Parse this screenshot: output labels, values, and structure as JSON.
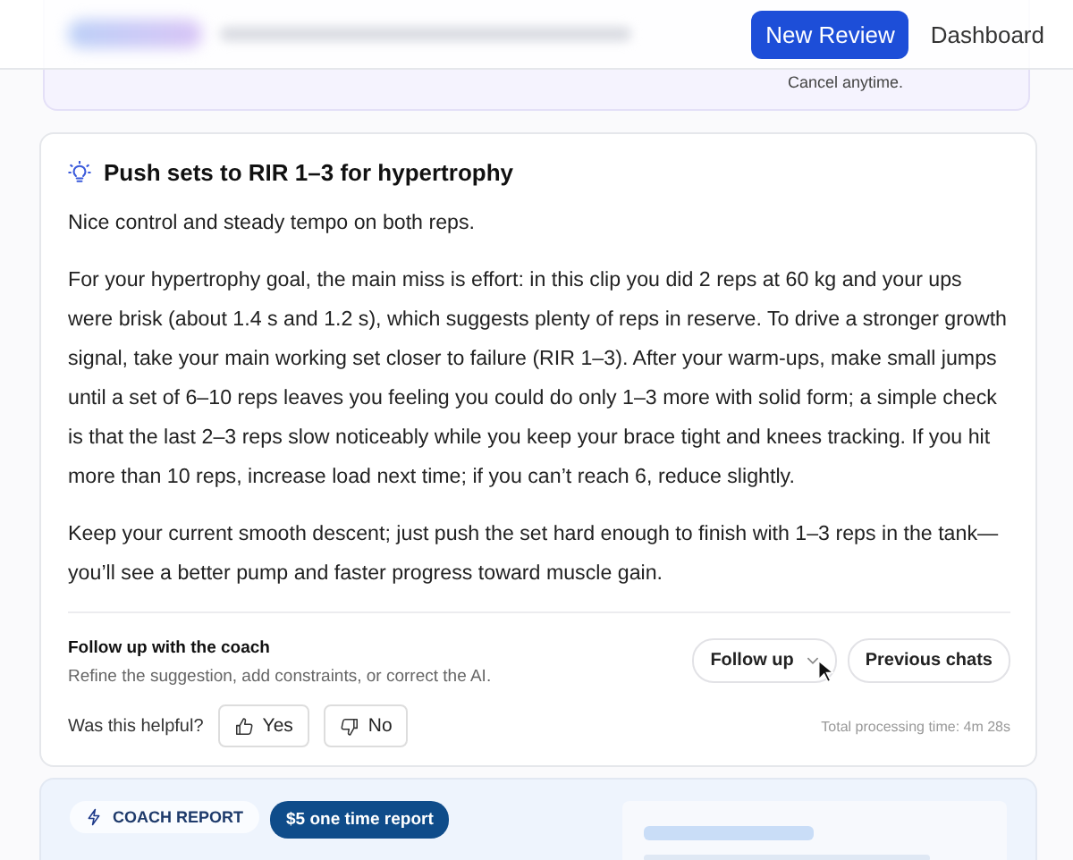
{
  "header": {
    "buttons": [
      {
        "label": "New Review",
        "selected": true
      },
      {
        "label": "Dashboard",
        "selected": false
      }
    ]
  },
  "banner": {
    "note": "Cancel anytime."
  },
  "suggestion": {
    "title": "Push sets to RIR 1–3 for hypertrophy",
    "paragraphs": [
      "Nice control and steady tempo on both reps.",
      "For your hypertrophy goal, the main miss is effort: in this clip you did 2 reps at 60 kg and your ups were brisk (about 1.4 s and 1.2 s), which suggests plenty of reps in reserve. To drive a stronger growth signal, take your main working set closer to failure (RIR 1–3). After your warm-ups, make small jumps until a set of 6–10 reps leaves you feeling you could do only 1–3 more with solid form; a simple check is that the last 2–3 reps slow noticeably while you keep your brace tight and knees tracking. If you hit more than 10 reps, increase load next time; if you can’t reach 6, reduce slightly.",
      "Keep your current smooth descent; just push the set hard enough to finish with 1–3 reps in the tank—you’ll see a better pump and faster progress toward muscle gain."
    ]
  },
  "follow_up": {
    "title": "Follow up with the coach",
    "subtitle": "Refine the suggestion, add constraints, or correct the AI.",
    "buttons": [
      "Follow up",
      "Previous chats"
    ]
  },
  "feedback": {
    "question": "Was this helpful?",
    "yes": "Yes",
    "no": "No",
    "processing_time": "Total processing time: 4m 28s"
  },
  "report": {
    "tag": "COACH REPORT",
    "price": "$5 one time report"
  }
}
